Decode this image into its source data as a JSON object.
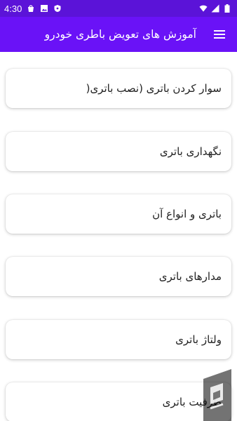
{
  "status_bar": {
    "time": "4:30",
    "left_icons": [
      "shopping-bag-icon",
      "image-icon",
      "shield-icon"
    ],
    "right_icons": [
      "wifi-icon",
      "signal-icon",
      "battery-icon"
    ]
  },
  "app_bar": {
    "title": "آموزش های تعویض باطری خودرو",
    "menu_icon": "hamburger-menu-icon"
  },
  "items": [
    {
      "label": "سوار کردن باتری (نصب باتری("
    },
    {
      "label": "نگهداری باتری"
    },
    {
      "label": "باتری و انواع آن"
    },
    {
      "label": "مدارهای باتری"
    },
    {
      "label": "ولتاژ باتری"
    },
    {
      "label": "ظرفیت باتری"
    }
  ],
  "colors": {
    "status_bar": "#5b13d8",
    "app_bar": "#6a12f7",
    "background": "#ffffff"
  },
  "watermark": {
    "icon": "bazaar-logo-icon"
  }
}
